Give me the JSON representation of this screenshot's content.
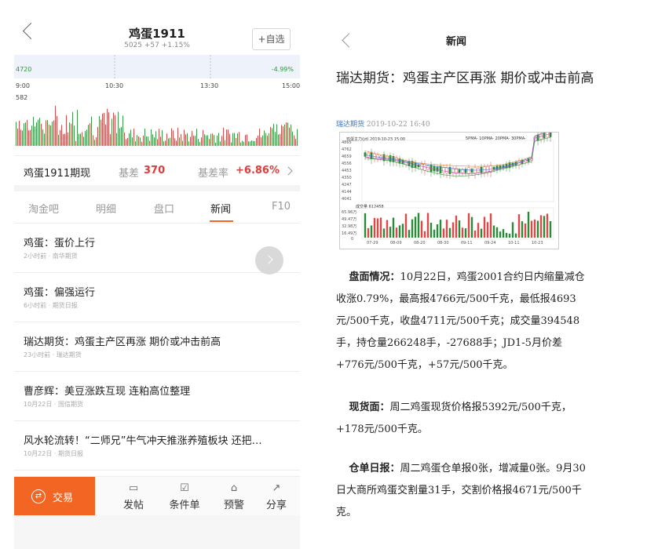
{
  "left": {
    "header": {
      "title": "鸡蛋1911",
      "subtitle": "5025 +57 +1.15%",
      "add_button": "+自选"
    },
    "chart": {
      "price_label": "4720",
      "pct_label": "-4.99%",
      "time_labels": [
        "9:00",
        "10:30",
        "13:30",
        "15:00"
      ],
      "volume_max": "582"
    },
    "basis": {
      "name": "鸡蛋1911期现",
      "basis_label": "基差",
      "basis_value": "370",
      "rate_label": "基差率",
      "rate_value": "+6.86%"
    },
    "tabs": [
      "淘金吧",
      "明细",
      "盘口",
      "新闻",
      "F10"
    ],
    "active_tab": "新闻",
    "news": [
      {
        "title": "鸡蛋：蛋价上行",
        "meta": "2小时前 · 南华期货"
      },
      {
        "title": "鸡蛋：偏强运行",
        "meta": "6小时前 · 期货日报"
      },
      {
        "title": "瑞达期货：鸡蛋主产区再涨 期价或冲击前高",
        "meta": "23小时前 · 瑞达期货"
      },
      {
        "title": "曹彦辉：美豆涨跌互现 连粕高位整理",
        "meta": "10月22日 · 国信期货"
      },
      {
        "title": "风水轮流转！“二师兄”牛气冲天推涨养殖板块 还把…",
        "meta": "10月22日 · 期货日报"
      }
    ],
    "bottom": {
      "trade": "交易",
      "items": [
        {
          "icon": "post-icon",
          "label": "发帖"
        },
        {
          "icon": "conditional-order-icon",
          "label": "条件单"
        },
        {
          "icon": "alert-icon",
          "label": "预警"
        },
        {
          "icon": "share-icon",
          "label": "分享"
        }
      ]
    }
  },
  "right": {
    "header_title": "新闻",
    "article_title": "瑞达期货：鸡蛋主产区再涨 期价或冲击前高",
    "source": "瑞达期货",
    "date": "2019-10-22 16:40",
    "image": {
      "header": "鸡蛋主力(jd) 2019-10-23 15:00",
      "ma_legend": "5PMA- 10PMA- 20PMA- 30PMA-",
      "y_labels": [
        "4865",
        "4762",
        "4659",
        "4556",
        "4453",
        "4350",
        "4247",
        "4144",
        "4041"
      ],
      "volume_label": "成交量 612458",
      "vol_labels": [
        "65.96万",
        "49.47万",
        "32.98万",
        "16.49万",
        "0"
      ],
      "x_labels": [
        "07-29",
        "08-09",
        "08-20",
        "08-30",
        "09-11",
        "09-24",
        "10-11",
        "10-23"
      ]
    },
    "paragraphs": [
      {
        "label": "盘面情况：",
        "text": "10月22日，鸡蛋2001合约日内缩量减仓收涨0.79%，最高报4766元/500千克，最低报4693元/500千克，收盘4711元/500千克；成交量394548手，持仓量266248手，-27688手；JD1-5月价差+776元/500千克，+57元/500千克。"
      },
      {
        "label": "现货面：",
        "text": "周二鸡蛋现货价格报5392元/500千克，+178元/500千克。"
      },
      {
        "label": "仓单日报：",
        "text": "周二鸡蛋仓单报0张，增减量0张。9月30日大商所鸡蛋交割量31手，交割价格报4671元/500千克。"
      }
    ]
  }
}
